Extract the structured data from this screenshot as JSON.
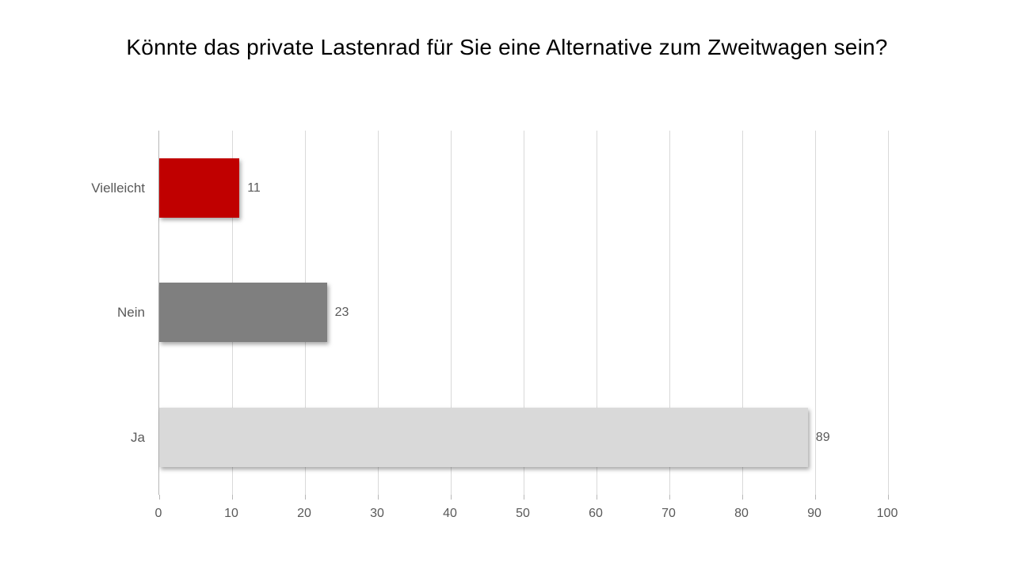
{
  "title": "Könnte das private Lastenrad für Sie eine Alternative zum Zweitwagen sein?",
  "chart_data": {
    "type": "bar",
    "orientation": "horizontal",
    "categories": [
      "Vielleicht",
      "Nein",
      "Ja"
    ],
    "values": [
      11,
      23,
      89
    ],
    "colors": [
      "#c00000",
      "#7f7f7f",
      "#d9d9d9"
    ],
    "xlim": [
      0,
      100
    ],
    "xticks": [
      0,
      10,
      20,
      30,
      40,
      50,
      60,
      70,
      80,
      90,
      100
    ],
    "title": "Könnte das private Lastenrad für Sie eine Alternative zum Zweitwagen sein?",
    "xlabel": "",
    "ylabel": ""
  },
  "cats": {
    "c0": "Vielleicht",
    "c1": "Nein",
    "c2": "Ja"
  },
  "vals": {
    "v0": "11",
    "v1": "23",
    "v2": "89"
  },
  "ticks": {
    "t0": "0",
    "t1": "10",
    "t2": "20",
    "t3": "30",
    "t4": "40",
    "t5": "50",
    "t6": "60",
    "t7": "70",
    "t8": "80",
    "t9": "90",
    "t10": "100"
  }
}
